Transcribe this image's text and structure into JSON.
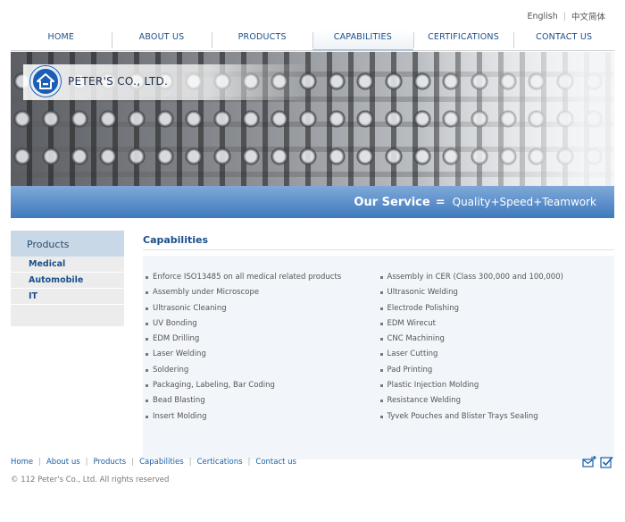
{
  "language": {
    "english": "English",
    "chinese": "中文简体"
  },
  "nav": [
    {
      "label": "HOME"
    },
    {
      "label": "ABOUT US"
    },
    {
      "label": "PRODUCTS"
    },
    {
      "label": "CAPABILITIES",
      "active": true
    },
    {
      "label": "CERTIFICATIONS"
    },
    {
      "label": "CONTACT US"
    }
  ],
  "brand": {
    "name": "PETER'S CO., LTD.",
    "logo_icon": "house-icon",
    "color": "#1a5fb4"
  },
  "service": {
    "title": "Our Service",
    "eq": "=",
    "motto": "Quality+Speed+Teamwork"
  },
  "sidebar": {
    "title": "Products",
    "items": [
      {
        "label": "Medical"
      },
      {
        "label": "Automobile"
      },
      {
        "label": "IT"
      }
    ]
  },
  "main": {
    "title": "Capabilities",
    "left": [
      "Enforce ISO13485 on all medical related products",
      "Assembly under Microscope",
      "Ultrasonic Cleaning",
      "UV Bonding",
      "EDM Drilling",
      "Laser Welding",
      "Soldering",
      "Packaging, Labeling, Bar Coding",
      "Bead Blasting",
      "Insert Molding"
    ],
    "right": [
      "Assembly in CER (Class 300,000 and 100,000)",
      "Ultrasonic Welding",
      "Electrode Polishing",
      "EDM Wirecut",
      "CNC Machining",
      "Laser Cutting",
      "Pad Printing",
      "Plastic Injection Molding",
      "Resistance Welding",
      "Tyvek Pouches and Blister Trays Sealing"
    ]
  },
  "footer": {
    "links": [
      {
        "label": "Home"
      },
      {
        "label": "About us"
      },
      {
        "label": "Products"
      },
      {
        "label": "Capabilities"
      },
      {
        "label": "Certications"
      },
      {
        "label": "Contact us"
      }
    ],
    "separator": "|",
    "copyright": "© 112  Peter's Co., Ltd.  All rights reserved",
    "icons": [
      "mail-forward-icon",
      "checkbox-icon"
    ]
  }
}
